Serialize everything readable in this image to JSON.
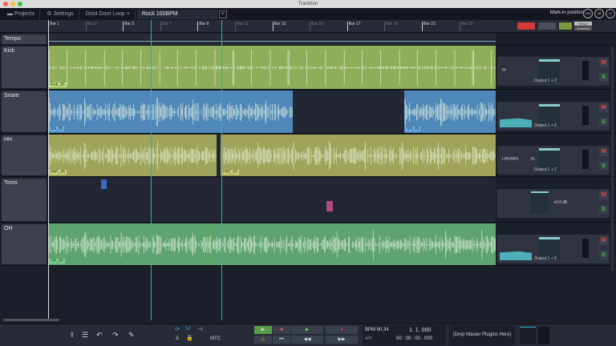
{
  "window": {
    "title": "Tracktion"
  },
  "tabs": [
    {
      "label": "Projects",
      "icon": "folder-icon"
    },
    {
      "label": "Settings",
      "icon": "gear-icon"
    },
    {
      "label": "Doot Doot Loop"
    },
    {
      "label": "Rock 100BPM"
    }
  ],
  "header": {
    "marker_label": "Mark-in position",
    "knob1": "100",
    "knob2": "48"
  },
  "ruler": {
    "bars": [
      "Bar 1",
      "Bar 3",
      "Bar 5",
      "Bar 7",
      "Bar 9",
      "Bar 11",
      "Bar 13",
      "Bar 15",
      "Bar 17",
      "Bar 19",
      "Bar 21",
      "Bar 23"
    ]
  },
  "toolbar_right": {
    "btn1": "Tempo",
    "btn2": "Quantize",
    "btn3": "Metronome"
  },
  "tracks": [
    {
      "name": "Tempo"
    },
    {
      "name": "Kick",
      "clips": [
        "Kick_05"
      ],
      "plugin": "Pi",
      "output": "Output 1 + 2"
    },
    {
      "name": "Snare",
      "clips": [
        "SN_05"
      ],
      "output": "Output 1 + 2"
    },
    {
      "name": "HH",
      "clips": [
        "HAT_05",
        "HAT_05"
      ],
      "plugin": "LPF/HPF",
      "plugin2": "Pi",
      "output": "Output 1 + 2"
    },
    {
      "name": "Toms",
      "plugin": "+0.0 dB"
    },
    {
      "name": "OH",
      "clips": [
        "OH_05"
      ],
      "output": "Output 1 + 2"
    }
  ],
  "mute_label": "M",
  "solo_label": "S",
  "transport": {
    "bpm": "BPM 90.34",
    "sig": "4/4",
    "bars": "1. 1. 000",
    "time": "00 : 00 : 00 . 000",
    "mtc": "MTC",
    "master": "(Drop Master Plugins Here)"
  },
  "colors": {
    "kick": "#8fae5c",
    "snare": "#4f87b8",
    "hh": "#9fa45a",
    "oh": "#5fa46e",
    "accent": "#3aa7b5"
  }
}
